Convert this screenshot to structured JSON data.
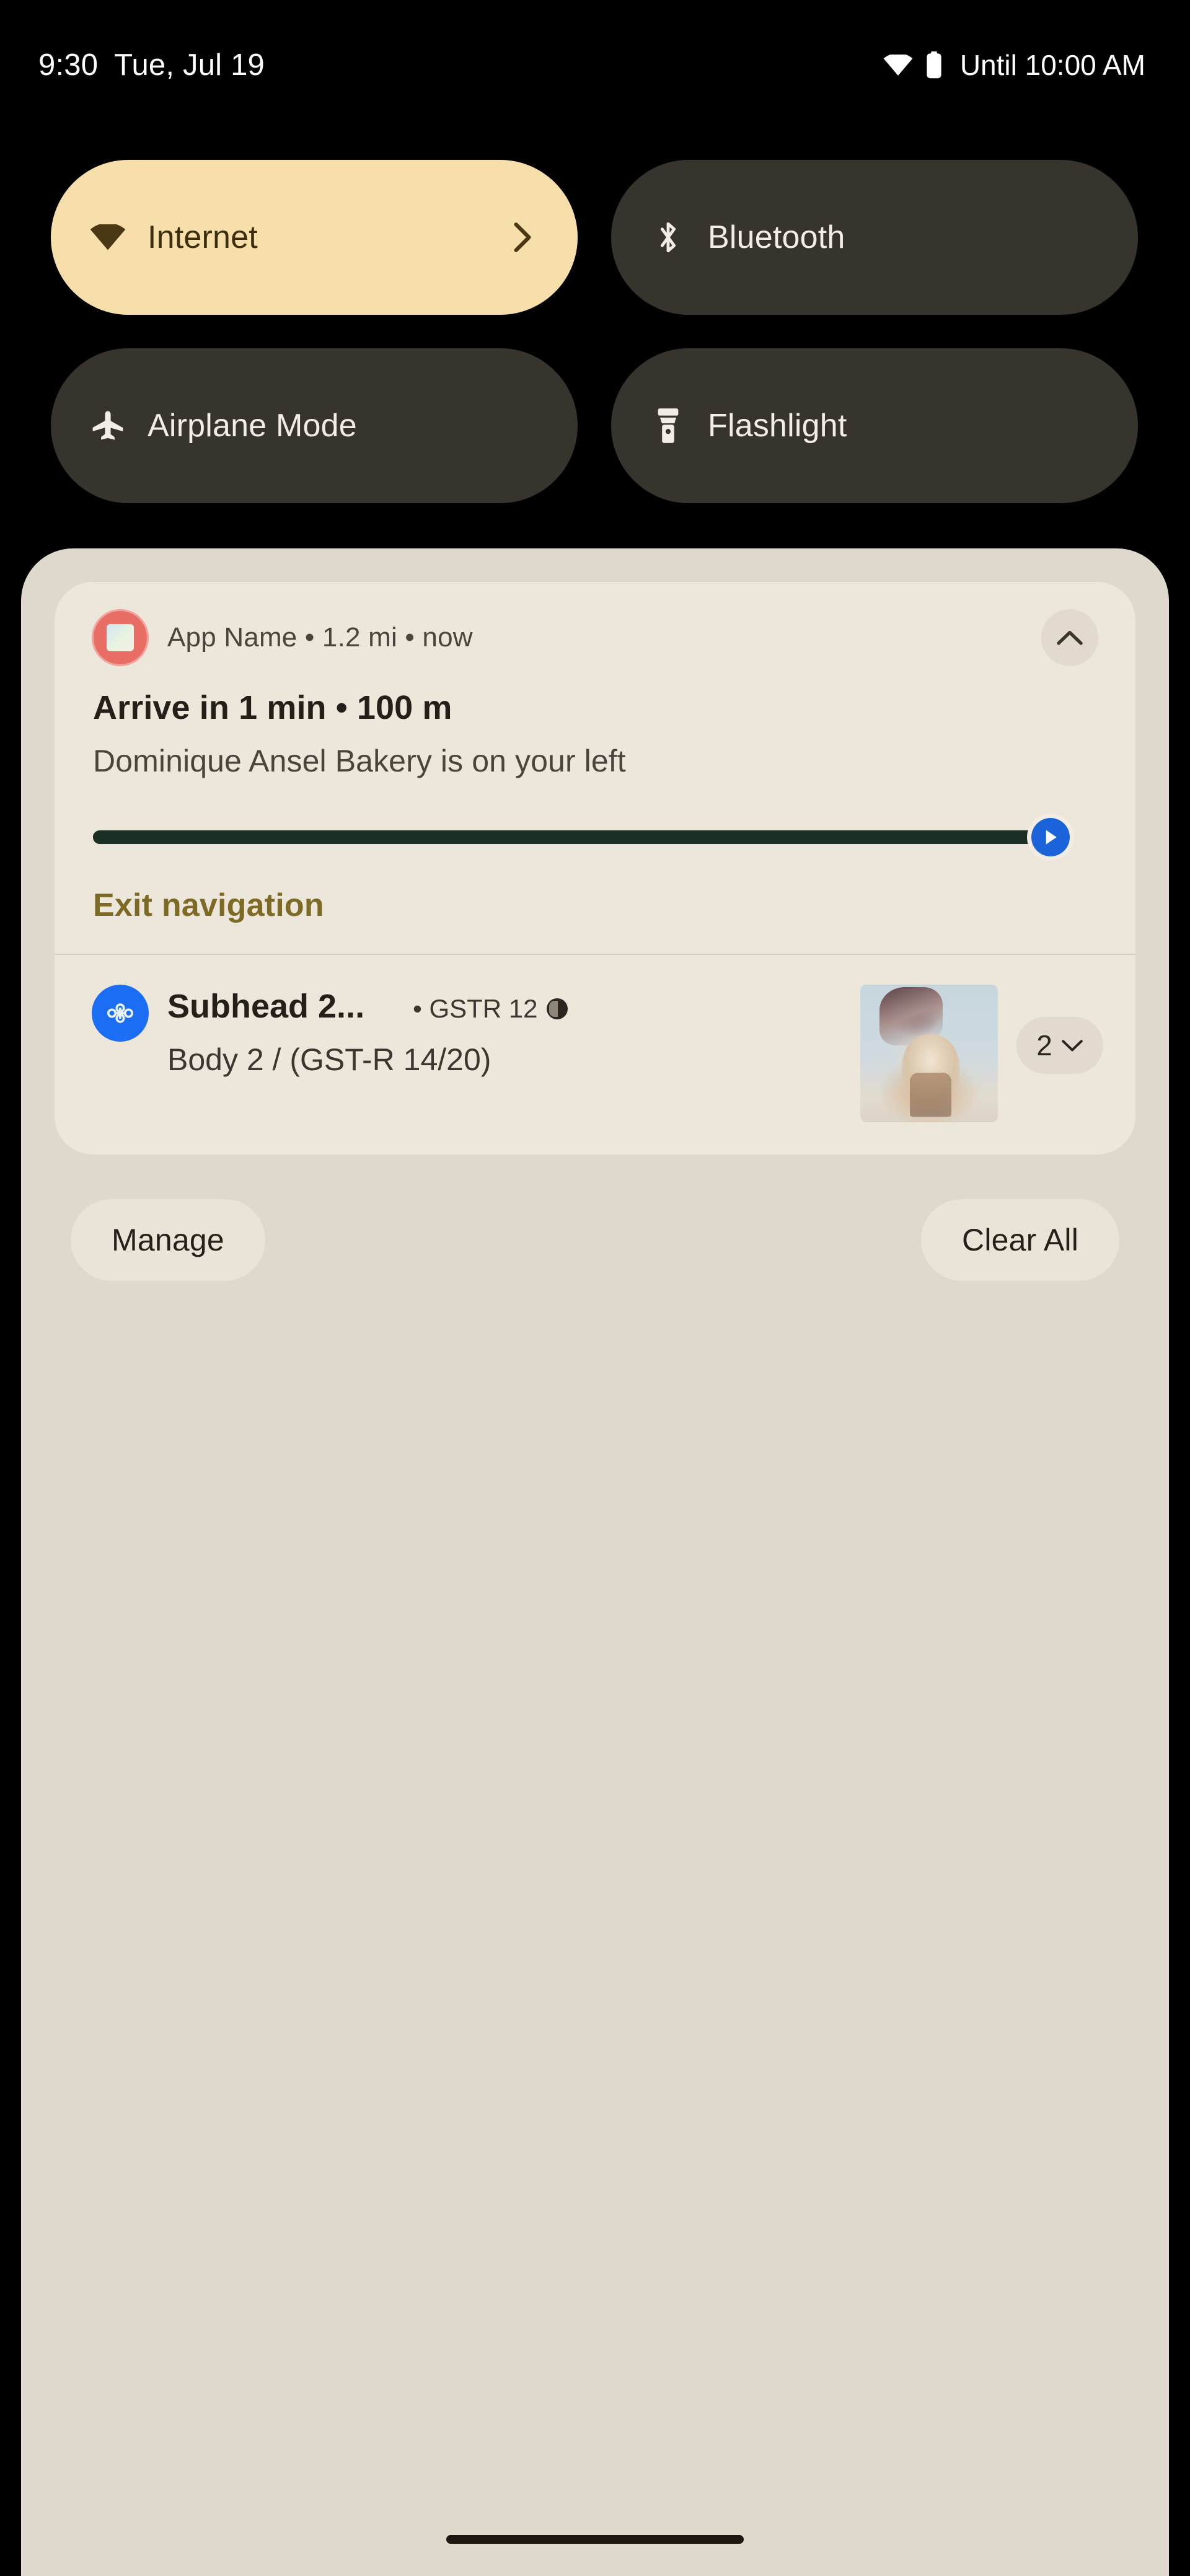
{
  "status_bar": {
    "time": "9:30",
    "date": "Tue, Jul 19",
    "wifi_icon": "wifi-icon",
    "battery_icon": "battery-full-icon",
    "dnd_text": "Until 10:00 AM"
  },
  "quick_settings": {
    "tiles": [
      {
        "label": "Internet",
        "icon": "wifi-icon",
        "state": "on",
        "has_chevron": true
      },
      {
        "label": "Bluetooth",
        "icon": "bluetooth-icon",
        "state": "off",
        "has_chevron": false
      },
      {
        "label": "Airplane Mode",
        "icon": "airplane-icon",
        "state": "off",
        "has_chevron": false
      },
      {
        "label": "Flashlight",
        "icon": "flashlight-icon",
        "state": "off",
        "has_chevron": false
      }
    ],
    "active_color": "#F6DFAA",
    "inactive_color": "#37342E"
  },
  "notifications": {
    "navigation": {
      "app_icon": "maps-app-icon",
      "meta": "App Name • 1.2 mi • now",
      "app_name": "App Name",
      "distance": "1.2 mi",
      "time": "now",
      "collapse_icon": "chevron-up-icon",
      "title": "Arrive in 1 min • 100 m",
      "body": "Dominique Ansel Bakery is on your left",
      "progress_percent": 100,
      "progress_color": "#1B2F25",
      "marker_icon": "navigation-arrow-icon",
      "marker_color": "#1B63D8",
      "action_label": "Exit navigation",
      "action_color": "#7D6B25"
    },
    "second": {
      "app_icon": "blue-app-icon",
      "subhead": "Subhead 2...",
      "meta": "• GSTR 12",
      "meta_badge_icon": "contrast-icon",
      "body": "Body 2 / (GST-R 14/20)",
      "thumbnail": "photo-thumbnail",
      "group_count": "2",
      "expand_icon": "chevron-down-icon"
    }
  },
  "footer": {
    "manage_label": "Manage",
    "clear_all_label": "Clear All"
  },
  "system": {
    "home_indicator": "home-indicator"
  }
}
